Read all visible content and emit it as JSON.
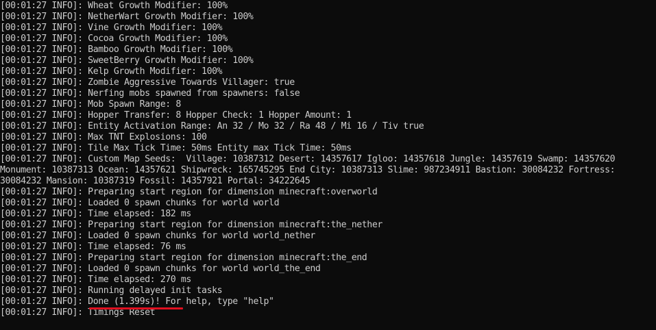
{
  "console": {
    "lines": [
      "[00:01:27 INFO]: Wheat Growth Modifier: 100%",
      "[00:01:27 INFO]: NetherWart Growth Modifier: 100%",
      "[00:01:27 INFO]: Vine Growth Modifier: 100%",
      "[00:01:27 INFO]: Cocoa Growth Modifier: 100%",
      "[00:01:27 INFO]: Bamboo Growth Modifier: 100%",
      "[00:01:27 INFO]: SweetBerry Growth Modifier: 100%",
      "[00:01:27 INFO]: Kelp Growth Modifier: 100%",
      "[00:01:27 INFO]: Zombie Aggressive Towards Villager: true",
      "[00:01:27 INFO]: Nerfing mobs spawned from spawners: false",
      "[00:01:27 INFO]: Mob Spawn Range: 8",
      "[00:01:27 INFO]: Hopper Transfer: 8 Hopper Check: 1 Hopper Amount: 1",
      "[00:01:27 INFO]: Entity Activation Range: An 32 / Mo 32 / Ra 48 / Mi 16 / Tiv true",
      "[00:01:27 INFO]: Max TNT Explosions: 100",
      "[00:01:27 INFO]: Tile Max Tick Time: 50ms Entity max Tick Time: 50ms",
      "[00:01:27 INFO]: Custom Map Seeds:  Village: 10387312 Desert: 14357617 Igloo: 14357618 Jungle: 14357619 Swamp: 14357620",
      "Monument: 10387313 Ocean: 14357621 Shipwreck: 165745295 End City: 10387313 Slime: 987234911 Bastion: 30084232 Fortress:",
      "30084232 Mansion: 10387319 Fossil: 14357921 Portal: 34222645",
      "[00:01:27 INFO]: Preparing start region for dimension minecraft:overworld",
      "[00:01:27 INFO]: Loaded 0 spawn chunks for world world",
      "[00:01:27 INFO]: Time elapsed: 182 ms",
      "[00:01:27 INFO]: Preparing start region for dimension minecraft:the_nether",
      "[00:01:27 INFO]: Loaded 0 spawn chunks for world world_nether",
      "[00:01:27 INFO]: Time elapsed: 76 ms",
      "[00:01:27 INFO]: Preparing start region for dimension minecraft:the_end",
      "[00:01:27 INFO]: Loaded 0 spawn chunks for world world_the_end",
      "[00:01:27 INFO]: Time elapsed: 270 ms",
      "[00:01:27 INFO]: Running delayed init tasks",
      "[00:01:27 INFO]: Done (1.399s)! For help, type \"help\"",
      "[00:01:27 INFO]: Timings Reset"
    ],
    "prompt": ">"
  },
  "colors": {
    "background": "#0c0c0c",
    "text": "#cccccc",
    "highlight_underline": "#e01020"
  }
}
